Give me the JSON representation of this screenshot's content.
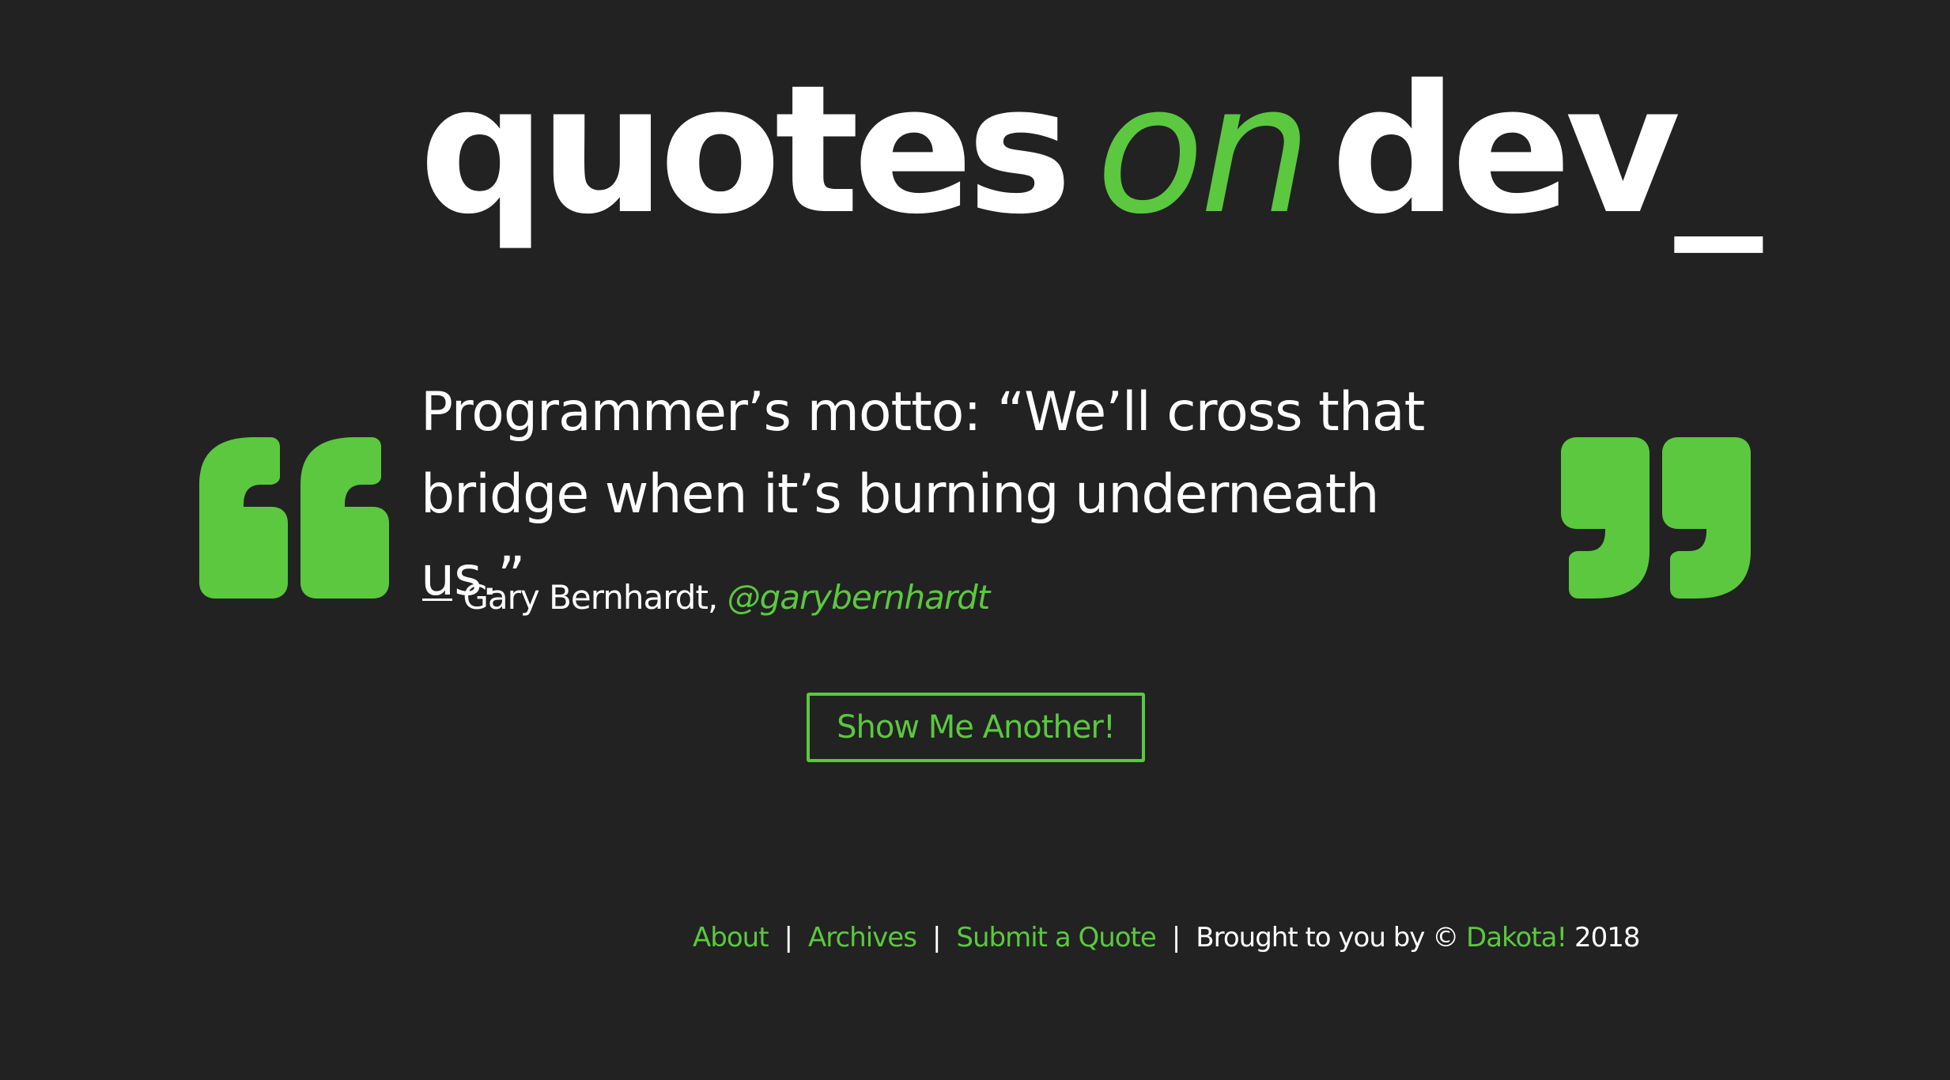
{
  "colors": {
    "background": "#222222",
    "accent": "#5bc83f",
    "text": "#ffffff"
  },
  "header": {
    "logo_part1": "quotes",
    "logo_part2": "on",
    "logo_part3": "dev_"
  },
  "quote": {
    "text": "Programmer’s motto: “We’ll cross that bridge when it’s burning underneath us.”",
    "author_prefix": "— Gary Bernhardt,",
    "author_handle": "@garybernhardt",
    "open_icon": "open-quote-icon",
    "close_icon": "close-quote-icon"
  },
  "actions": {
    "show_another_label": "Show Me Another!"
  },
  "footer": {
    "links": {
      "about": "About",
      "archives": "Archives",
      "submit": "Submit a Quote"
    },
    "separator": "|",
    "credit_prefix": "Brought to you by ©",
    "credit_name": "Dakota!",
    "credit_year": "2018"
  }
}
